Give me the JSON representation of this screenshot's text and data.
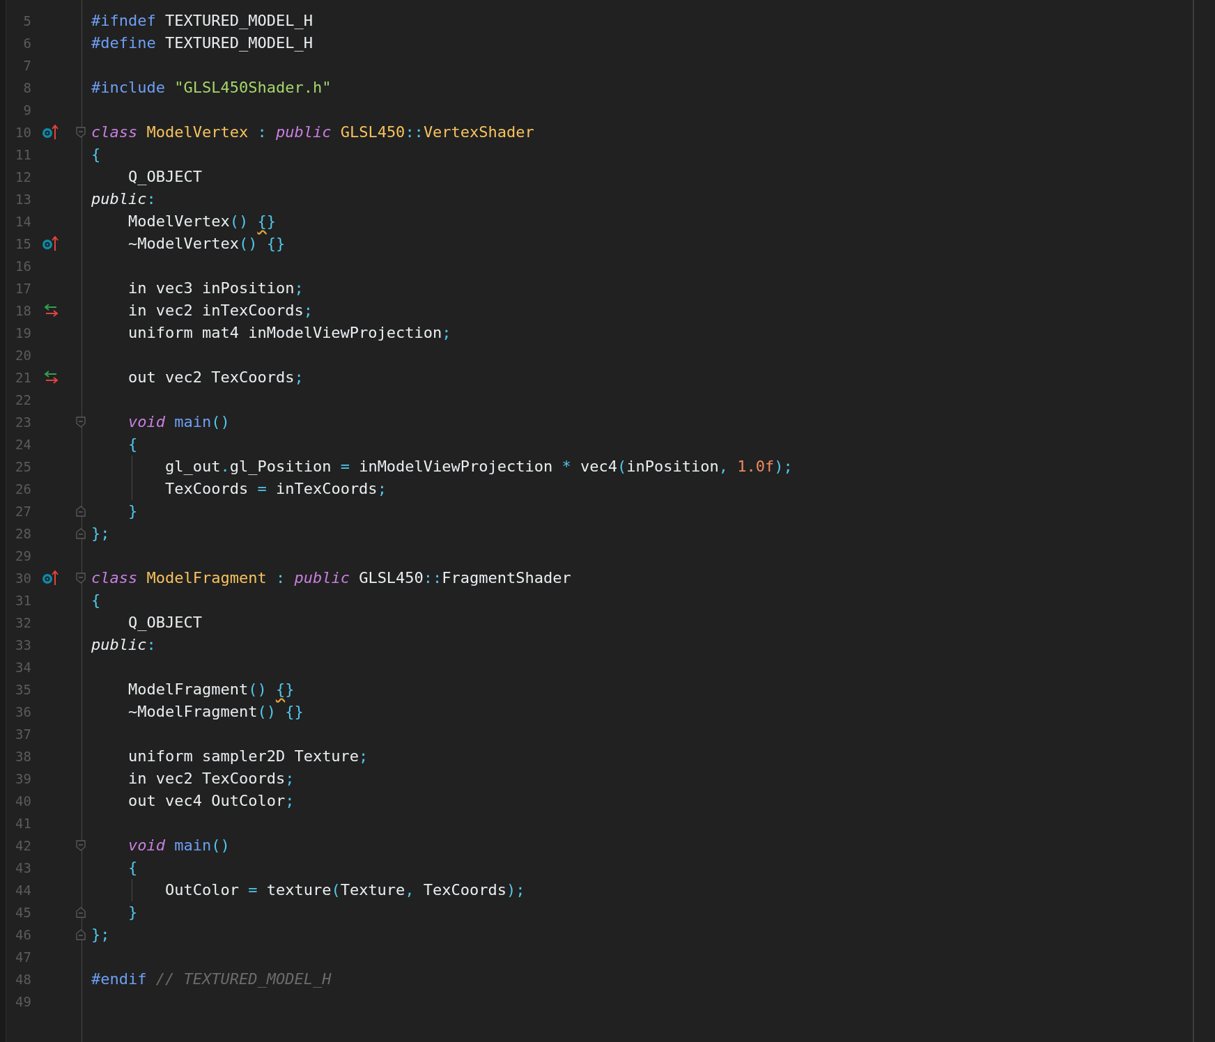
{
  "editor": {
    "lines": [
      {
        "number": "5",
        "guide": false,
        "tokens": [
          {
            "kind": "p",
            "text": "#ifndef"
          },
          {
            "kind": "x",
            "text": " TEXTURED_MODEL_H"
          }
        ]
      },
      {
        "number": "6",
        "guide": false,
        "tokens": [
          {
            "kind": "p",
            "text": "#define"
          },
          {
            "kind": "x",
            "text": " TEXTURED_MODEL_H"
          }
        ]
      },
      {
        "number": "7",
        "guide": false
      },
      {
        "number": "8",
        "guide": false,
        "tokens": [
          {
            "kind": "p",
            "text": "#include"
          },
          {
            "kind": "s",
            "text": " \"GLSL450Shader.h\""
          }
        ]
      },
      {
        "number": "9",
        "guide": false
      },
      {
        "number": "10",
        "marker": {
          "kind": "override"
        },
        "fold": {
          "kind": "start"
        },
        "guide": false,
        "tokens": [
          {
            "kind": "k",
            "text": "class"
          },
          {
            "kind": "t",
            "text": " ModelVertex"
          },
          {
            "kind": "c",
            "text": " :"
          },
          {
            "kind": "k",
            "text": " public"
          },
          {
            "kind": "t",
            "text": " GLSL450"
          },
          {
            "kind": "c",
            "text": "::"
          },
          {
            "kind": "t",
            "text": "VertexShader"
          }
        ]
      },
      {
        "number": "11",
        "guide": false,
        "tokens": [
          {
            "kind": "c",
            "text": "{"
          }
        ]
      },
      {
        "number": "12",
        "guide": false,
        "tokens": [
          {
            "kind": "x",
            "text": "    Q_OBJECT"
          }
        ]
      },
      {
        "number": "13",
        "guide": false,
        "tokens": [
          {
            "kind": "i",
            "text": "public"
          },
          {
            "kind": "c",
            "text": ":"
          }
        ]
      },
      {
        "number": "14",
        "guide": false,
        "tokens": [
          {
            "kind": "x",
            "text": "    ModelVertex"
          },
          {
            "kind": "c",
            "text": "() "
          },
          {
            "kind": "w",
            "text": "{"
          },
          {
            "kind": "c",
            "text": "}"
          }
        ]
      },
      {
        "number": "15",
        "marker": {
          "kind": "override"
        },
        "guide": false,
        "tokens": [
          {
            "kind": "x",
            "text": "    ~ModelVertex"
          },
          {
            "kind": "c",
            "text": "() {}"
          }
        ]
      },
      {
        "number": "16",
        "guide": false
      },
      {
        "number": "17",
        "guide": false,
        "tokens": [
          {
            "kind": "x",
            "text": "    in vec3 inPosition"
          },
          {
            "kind": "c",
            "text": ";"
          }
        ]
      },
      {
        "number": "18",
        "marker": {
          "kind": "inout"
        },
        "guide": false,
        "tokens": [
          {
            "kind": "x",
            "text": "    in vec2 inTexCoords"
          },
          {
            "kind": "c",
            "text": ";"
          }
        ]
      },
      {
        "number": "19",
        "guide": false,
        "tokens": [
          {
            "kind": "x",
            "text": "    uniform mat4 inModelViewProjection"
          },
          {
            "kind": "c",
            "text": ";"
          }
        ]
      },
      {
        "number": "20",
        "guide": false
      },
      {
        "number": "21",
        "marker": {
          "kind": "inout"
        },
        "guide": false,
        "tokens": [
          {
            "kind": "x",
            "text": "    out vec2 TexCoords"
          },
          {
            "kind": "c",
            "text": ";"
          }
        ]
      },
      {
        "number": "22",
        "guide": false
      },
      {
        "number": "23",
        "fold": {
          "kind": "start"
        },
        "guide": false,
        "tokens": [
          {
            "kind": "k",
            "text": "    void"
          },
          {
            "kind": "f",
            "text": " main"
          },
          {
            "kind": "c",
            "text": "()"
          }
        ]
      },
      {
        "number": "24",
        "guide": false,
        "tokens": [
          {
            "kind": "c",
            "text": "    {"
          }
        ]
      },
      {
        "number": "25",
        "guide": true,
        "tokens": [
          {
            "kind": "x",
            "text": "        gl_out"
          },
          {
            "kind": "c",
            "text": "."
          },
          {
            "kind": "x",
            "text": "gl_Position "
          },
          {
            "kind": "c",
            "text": "="
          },
          {
            "kind": "x",
            "text": " inModelViewProjection "
          },
          {
            "kind": "c",
            "text": "*"
          },
          {
            "kind": "x",
            "text": " vec4"
          },
          {
            "kind": "c",
            "text": "("
          },
          {
            "kind": "x",
            "text": "inPosition"
          },
          {
            "kind": "c",
            "text": ","
          },
          {
            "kind": "n",
            "text": " 1.0f"
          },
          {
            "kind": "c",
            "text": ");"
          }
        ]
      },
      {
        "number": "26",
        "guide": true,
        "tokens": [
          {
            "kind": "x",
            "text": "        TexCoords "
          },
          {
            "kind": "c",
            "text": "="
          },
          {
            "kind": "x",
            "text": " inTexCoords"
          },
          {
            "kind": "c",
            "text": ";"
          }
        ]
      },
      {
        "number": "27",
        "fold": {
          "kind": "end"
        },
        "guide": false,
        "tokens": [
          {
            "kind": "c",
            "text": "    }"
          }
        ]
      },
      {
        "number": "28",
        "fold": {
          "kind": "end"
        },
        "guide": false,
        "tokens": [
          {
            "kind": "c",
            "text": "};"
          }
        ]
      },
      {
        "number": "29",
        "guide": false
      },
      {
        "number": "30",
        "marker": {
          "kind": "override"
        },
        "fold": {
          "kind": "start"
        },
        "guide": false,
        "tokens": [
          {
            "kind": "k",
            "text": "class"
          },
          {
            "kind": "t",
            "text": " ModelFragment"
          },
          {
            "kind": "c",
            "text": " :"
          },
          {
            "kind": "k",
            "text": " public"
          },
          {
            "kind": "x",
            "text": " GLSL450"
          },
          {
            "kind": "c",
            "text": "::"
          },
          {
            "kind": "x",
            "text": "FragmentShader"
          }
        ]
      },
      {
        "number": "31",
        "guide": false,
        "tokens": [
          {
            "kind": "c",
            "text": "{"
          }
        ]
      },
      {
        "number": "32",
        "guide": false,
        "tokens": [
          {
            "kind": "x",
            "text": "    Q_OBJECT"
          }
        ]
      },
      {
        "number": "33",
        "guide": false,
        "tokens": [
          {
            "kind": "i",
            "text": "public"
          },
          {
            "kind": "c",
            "text": ":"
          }
        ]
      },
      {
        "number": "34",
        "guide": false
      },
      {
        "number": "35",
        "guide": false,
        "tokens": [
          {
            "kind": "x",
            "text": "    ModelFragment"
          },
          {
            "kind": "c",
            "text": "() "
          },
          {
            "kind": "w",
            "text": "{"
          },
          {
            "kind": "c",
            "text": "}"
          }
        ]
      },
      {
        "number": "36",
        "guide": false,
        "tokens": [
          {
            "kind": "x",
            "text": "    ~ModelFragment"
          },
          {
            "kind": "c",
            "text": "() {}"
          }
        ]
      },
      {
        "number": "37",
        "guide": false
      },
      {
        "number": "38",
        "guide": false,
        "tokens": [
          {
            "kind": "x",
            "text": "    uniform sampler2D Texture"
          },
          {
            "kind": "c",
            "text": ";"
          }
        ]
      },
      {
        "number": "39",
        "guide": false,
        "tokens": [
          {
            "kind": "x",
            "text": "    in vec2 TexCoords"
          },
          {
            "kind": "c",
            "text": ";"
          }
        ]
      },
      {
        "number": "40",
        "guide": false,
        "tokens": [
          {
            "kind": "x",
            "text": "    out vec4 OutColor"
          },
          {
            "kind": "c",
            "text": ";"
          }
        ]
      },
      {
        "number": "41",
        "guide": false
      },
      {
        "number": "42",
        "fold": {
          "kind": "start"
        },
        "guide": false,
        "tokens": [
          {
            "kind": "k",
            "text": "    void"
          },
          {
            "kind": "f",
            "text": " main"
          },
          {
            "kind": "c",
            "text": "()"
          }
        ]
      },
      {
        "number": "43",
        "guide": false,
        "tokens": [
          {
            "kind": "c",
            "text": "    {"
          }
        ]
      },
      {
        "number": "44",
        "guide": true,
        "tokens": [
          {
            "kind": "x",
            "text": "        OutColor "
          },
          {
            "kind": "c",
            "text": "="
          },
          {
            "kind": "x",
            "text": " texture"
          },
          {
            "kind": "c",
            "text": "("
          },
          {
            "kind": "x",
            "text": "Texture"
          },
          {
            "kind": "c",
            "text": ","
          },
          {
            "kind": "x",
            "text": " TexCoords"
          },
          {
            "kind": "c",
            "text": ");"
          }
        ]
      },
      {
        "number": "45",
        "fold": {
          "kind": "end"
        },
        "guide": false,
        "tokens": [
          {
            "kind": "c",
            "text": "    }"
          }
        ]
      },
      {
        "number": "46",
        "fold": {
          "kind": "end"
        },
        "guide": false,
        "tokens": [
          {
            "kind": "c",
            "text": "};"
          }
        ]
      },
      {
        "number": "47",
        "guide": false
      },
      {
        "number": "48",
        "guide": false,
        "tokens": [
          {
            "kind": "p",
            "text": "#endif"
          },
          {
            "kind": "m",
            "text": " // TEXTURED_MODEL_H"
          }
        ]
      },
      {
        "number": "49",
        "guide": false
      }
    ]
  }
}
